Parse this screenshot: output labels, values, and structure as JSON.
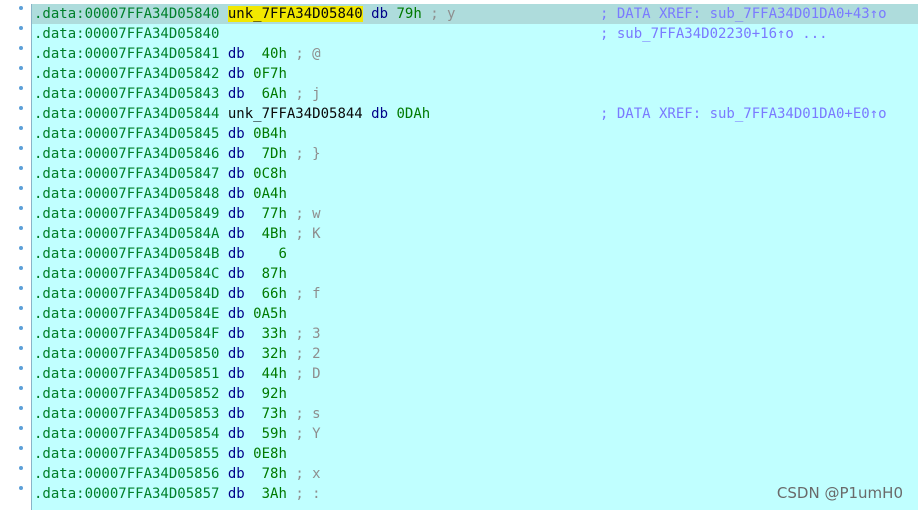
{
  "listing": {
    "rows": [
      {
        "addr": ".data:00007FFA34D05840",
        "name": "unk_7FFA34D05840",
        "highlight": true,
        "mnem": "db",
        "value": "79h",
        "comment": "; y",
        "xref": "; DATA XREF: sub_7FFA34D01DA0+43↑o",
        "selected": true
      },
      {
        "addr": ".data:00007FFA34D05840",
        "name": "",
        "highlight": false,
        "mnem": "",
        "value": "",
        "comment": "",
        "xref": "; sub_7FFA34D02230+16↑o ...",
        "selected": false
      },
      {
        "addr": ".data:00007FFA34D05841",
        "name": "",
        "highlight": false,
        "mnem": "db",
        "value": " 40h",
        "comment": "; @",
        "xref": "",
        "selected": false
      },
      {
        "addr": ".data:00007FFA34D05842",
        "name": "",
        "highlight": false,
        "mnem": "db",
        "value": "0F7h",
        "comment": "",
        "xref": "",
        "selected": false
      },
      {
        "addr": ".data:00007FFA34D05843",
        "name": "",
        "highlight": false,
        "mnem": "db",
        "value": " 6Ah",
        "comment": "; j",
        "xref": "",
        "selected": false
      },
      {
        "addr": ".data:00007FFA34D05844",
        "name": "unk_7FFA34D05844",
        "highlight": false,
        "mnem": "db",
        "value": "0DAh",
        "comment": "",
        "xref": "; DATA XREF: sub_7FFA34D01DA0+E0↑o",
        "selected": false
      },
      {
        "addr": ".data:00007FFA34D05845",
        "name": "",
        "highlight": false,
        "mnem": "db",
        "value": "0B4h",
        "comment": "",
        "xref": "",
        "selected": false
      },
      {
        "addr": ".data:00007FFA34D05846",
        "name": "",
        "highlight": false,
        "mnem": "db",
        "value": " 7Dh",
        "comment": "; }",
        "xref": "",
        "selected": false
      },
      {
        "addr": ".data:00007FFA34D05847",
        "name": "",
        "highlight": false,
        "mnem": "db",
        "value": "0C8h",
        "comment": "",
        "xref": "",
        "selected": false
      },
      {
        "addr": ".data:00007FFA34D05848",
        "name": "",
        "highlight": false,
        "mnem": "db",
        "value": "0A4h",
        "comment": "",
        "xref": "",
        "selected": false
      },
      {
        "addr": ".data:00007FFA34D05849",
        "name": "",
        "highlight": false,
        "mnem": "db",
        "value": " 77h",
        "comment": "; w",
        "xref": "",
        "selected": false
      },
      {
        "addr": ".data:00007FFA34D0584A",
        "name": "",
        "highlight": false,
        "mnem": "db",
        "value": " 4Bh",
        "comment": "; K",
        "xref": "",
        "selected": false
      },
      {
        "addr": ".data:00007FFA34D0584B",
        "name": "",
        "highlight": false,
        "mnem": "db",
        "value": "   6",
        "comment": "",
        "xref": "",
        "selected": false
      },
      {
        "addr": ".data:00007FFA34D0584C",
        "name": "",
        "highlight": false,
        "mnem": "db",
        "value": " 87h",
        "comment": "",
        "xref": "",
        "selected": false
      },
      {
        "addr": ".data:00007FFA34D0584D",
        "name": "",
        "highlight": false,
        "mnem": "db",
        "value": " 66h",
        "comment": "; f",
        "xref": "",
        "selected": false
      },
      {
        "addr": ".data:00007FFA34D0584E",
        "name": "",
        "highlight": false,
        "mnem": "db",
        "value": "0A5h",
        "comment": "",
        "xref": "",
        "selected": false
      },
      {
        "addr": ".data:00007FFA34D0584F",
        "name": "",
        "highlight": false,
        "mnem": "db",
        "value": " 33h",
        "comment": "; 3",
        "xref": "",
        "selected": false
      },
      {
        "addr": ".data:00007FFA34D05850",
        "name": "",
        "highlight": false,
        "mnem": "db",
        "value": " 32h",
        "comment": "; 2",
        "xref": "",
        "selected": false
      },
      {
        "addr": ".data:00007FFA34D05851",
        "name": "",
        "highlight": false,
        "mnem": "db",
        "value": " 44h",
        "comment": "; D",
        "xref": "",
        "selected": false
      },
      {
        "addr": ".data:00007FFA34D05852",
        "name": "",
        "highlight": false,
        "mnem": "db",
        "value": " 92h",
        "comment": "",
        "xref": "",
        "selected": false
      },
      {
        "addr": ".data:00007FFA34D05853",
        "name": "",
        "highlight": false,
        "mnem": "db",
        "value": " 73h",
        "comment": "; s",
        "xref": "",
        "selected": false
      },
      {
        "addr": ".data:00007FFA34D05854",
        "name": "",
        "highlight": false,
        "mnem": "db",
        "value": " 59h",
        "comment": "; Y",
        "xref": "",
        "selected": false
      },
      {
        "addr": ".data:00007FFA34D05855",
        "name": "",
        "highlight": false,
        "mnem": "db",
        "value": "0E8h",
        "comment": "",
        "xref": "",
        "selected": false
      },
      {
        "addr": ".data:00007FFA34D05856",
        "name": "",
        "highlight": false,
        "mnem": "db",
        "value": " 78h",
        "comment": "; x",
        "xref": "",
        "selected": false
      },
      {
        "addr": ".data:00007FFA34D05857",
        "name": "",
        "highlight": false,
        "mnem": "db",
        "value": " 3Ah",
        "comment": "; :",
        "xref": "",
        "selected": false
      }
    ]
  },
  "watermark": "CSDN @P1umH0",
  "colors": {
    "background": "#c0ffff",
    "selected_row": "#aedcdc",
    "address": "#00802a",
    "mnemonic": "#00008a",
    "value": "#007a00",
    "comment": "#8e8e8e",
    "xref": "#7a7aff",
    "name_highlight": "#f2e800"
  }
}
